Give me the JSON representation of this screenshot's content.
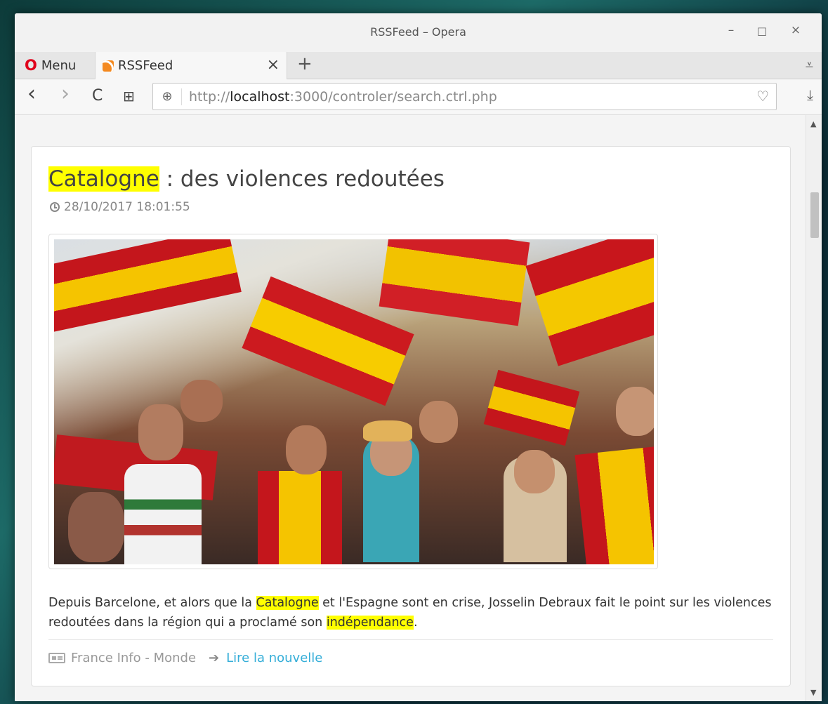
{
  "window": {
    "title": "RSSFeed – Opera",
    "minimize_glyph": "–",
    "maximize_glyph": "□",
    "close_glyph": "×"
  },
  "tabs": {
    "menu_label": "Menu",
    "active_tab": {
      "label": "RSSFeed",
      "icon": "rss-icon"
    },
    "close_glyph": "×",
    "new_tab_glyph": "+",
    "tab_menu_glyph": "⩡"
  },
  "address_bar": {
    "back_glyph": "‹",
    "forward_glyph": "›",
    "reload_glyph": "C",
    "speed_dial_glyph": "⊞",
    "url_scheme": "http://",
    "url_host": "localhost",
    "url_rest": ":3000/controler/search.ctrl.php",
    "bookmark_glyph": "♡",
    "download_glyph": "⤓"
  },
  "article": {
    "title_highlight": "Catalogne",
    "title_rest": " : des violences redoutées",
    "date": "28/10/2017 18:01:55",
    "image_alt": "Manifestants brandissant des drapeaux espagnols",
    "desc_part1": "Depuis Barcelone, et alors que la ",
    "desc_hl1": "Catalogne",
    "desc_part2": " et l'Espagne sont en crise, Josselin Debraux fait le point sur les violences redoutées dans la région qui a proclamé son ",
    "desc_hl2": "indépendance",
    "desc_part3": ".",
    "source": "France Info - Monde",
    "read_more": "Lire la nouvelle"
  },
  "colors": {
    "highlight": "#ffff00",
    "link": "#35aed8",
    "opera_red": "#e0001b"
  }
}
